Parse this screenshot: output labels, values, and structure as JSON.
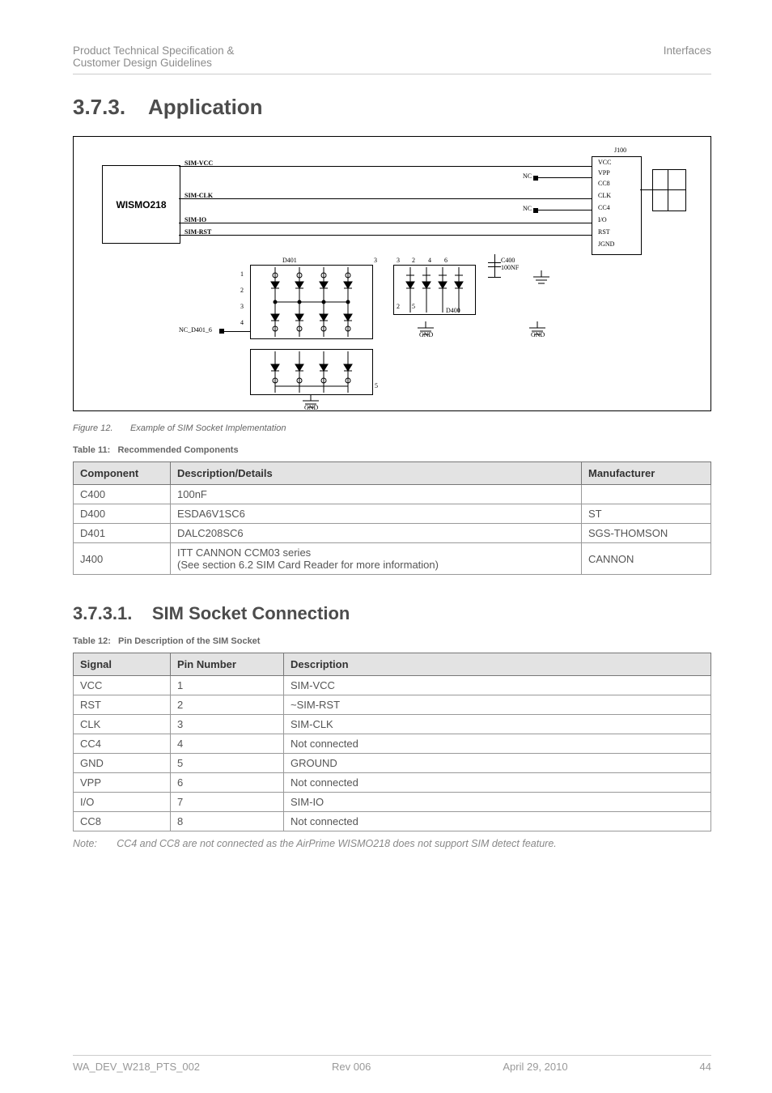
{
  "header": {
    "left1": "Product Technical Specification &",
    "left2": "Customer Design Guidelines",
    "right": "Interfaces"
  },
  "sections": {
    "h2_num": "3.7.3.",
    "h2_title": "Application",
    "h3_num": "3.7.3.1.",
    "h3_title": "SIM Socket Connection"
  },
  "figure": {
    "caption_num": "Figure 12.",
    "caption_text": "Example of SIM Socket Implementation",
    "labels": {
      "chip": "WISMO218",
      "sim_vcc": "SIM-VCC",
      "sim_clk": "SIM-CLK",
      "sim_io": "SIM-IO",
      "sim_rst": "SIM-RST",
      "nc": "NC",
      "j100": "J100",
      "vcc": "VCC",
      "vpp": "VPP",
      "cc8": "CC8",
      "clk": "CLK",
      "cc4": "CC4",
      "io": "I/O",
      "rst": "RST",
      "jgnd": "JGND",
      "gnd": "GND",
      "d401": "D401",
      "d400": "D400",
      "c400": "C400\n100NF",
      "nc_d401": "NC_D401_6"
    }
  },
  "table11": {
    "caption_num": "Table 11:",
    "caption_text": "Recommended Components",
    "headers": [
      "Component",
      "Description/Details",
      "Manufacturer"
    ],
    "rows": [
      [
        "C400",
        "100nF",
        ""
      ],
      [
        "D400",
        "ESDA6V1SC6",
        "ST"
      ],
      [
        "D401",
        "DALC208SC6",
        "SGS-THOMSON"
      ],
      [
        "J400",
        "ITT CANNON CCM03 series\n(See section 6.2 SIM Card Reader for more information)",
        "CANNON"
      ]
    ]
  },
  "table12": {
    "caption_num": "Table 12:",
    "caption_text": "Pin Description of the SIM Socket",
    "headers": [
      "Signal",
      "Pin Number",
      "Description"
    ],
    "rows": [
      [
        "VCC",
        "1",
        "SIM-VCC"
      ],
      [
        "RST",
        "2",
        "~SIM-RST"
      ],
      [
        "CLK",
        "3",
        "SIM-CLK"
      ],
      [
        "CC4",
        "4",
        "Not connected"
      ],
      [
        "GND",
        "5",
        "GROUND"
      ],
      [
        "VPP",
        "6",
        "Not connected"
      ],
      [
        "I/O",
        "7",
        "SIM-IO"
      ],
      [
        "CC8",
        "8",
        "Not connected"
      ]
    ]
  },
  "note": {
    "label": "Note:",
    "text": "CC4 and CC8 are not connected as the AirPrime WISMO218 does not support SIM detect feature."
  },
  "footer": {
    "left": "WA_DEV_W218_PTS_002",
    "mid": "Rev 006",
    "right": "April 29, 2010",
    "page": "44"
  }
}
